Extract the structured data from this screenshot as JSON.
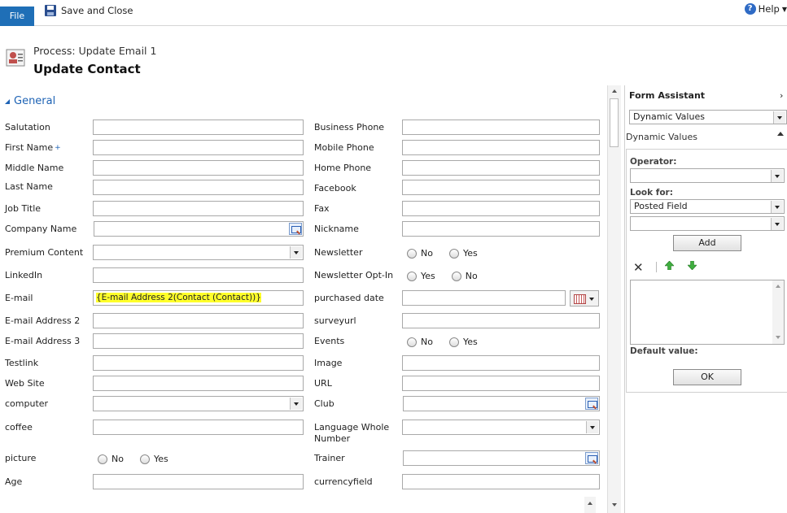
{
  "ribbon": {
    "file_label": "File",
    "save_close_label": "Save and Close",
    "help_label": "Help"
  },
  "header": {
    "process_line": "Process: Update Email 1",
    "title": "Update Contact"
  },
  "section": {
    "title": "General"
  },
  "form": {
    "left": {
      "salutation": "Salutation",
      "first_name": "First Name",
      "first_name_required": "+",
      "middle_name": "Middle Name",
      "last_name": "Last Name",
      "job_title": "Job Title",
      "company_name": "Company Name",
      "premium_content": "Premium Content",
      "linkedin": "LinkedIn",
      "email": "E-mail",
      "email_value": "{E-mail Address 2(Contact (Contact))}",
      "email2": "E-mail Address 2",
      "email3": "E-mail Address 3",
      "testlink": "Testlink",
      "website": "Web Site",
      "computer": "computer",
      "coffee": "coffee",
      "picture": "picture",
      "age": "Age"
    },
    "right": {
      "business_phone": "Business Phone",
      "mobile_phone": "Mobile Phone",
      "home_phone": "Home Phone",
      "facebook": "Facebook",
      "fax": "Fax",
      "nickname": "Nickname",
      "newsletter": "Newsletter",
      "newsletter_optin": "Newsletter Opt-In",
      "purchased_date": "purchased date",
      "surveyurl": "surveyurl",
      "events": "Events",
      "image": "Image",
      "url": "URL",
      "club": "Club",
      "language_whole_number": "Language Whole Number",
      "trainer": "Trainer",
      "currencyfield": "currencyfield"
    },
    "radio": {
      "no": "No",
      "yes": "Yes"
    }
  },
  "assistant": {
    "title": "Form Assistant",
    "top_select": "Dynamic Values",
    "section_title": "Dynamic Values",
    "operator_label": "Operator:",
    "operator_value": "",
    "lookfor_label": "Look for:",
    "lookfor_value": "Posted Field",
    "lookfor2_value": "",
    "add_label": "Add",
    "default_label": "Default value:",
    "ok_label": "OK"
  },
  "colors": {
    "accent": "#1f6fb7",
    "highlight": "#ffff2a"
  }
}
